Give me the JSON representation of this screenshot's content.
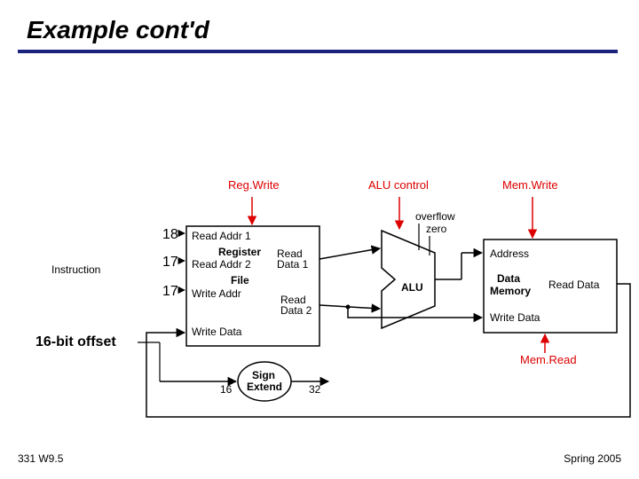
{
  "title": "Example cont'd",
  "signals": {
    "regwrite": "Reg.Write",
    "alucontrol": "ALU control",
    "memwrite": "Mem.Write",
    "memread": "Mem.Read",
    "overflow": "overflow",
    "zero": "zero"
  },
  "reg_inputs": {
    "a": "18",
    "b": "17",
    "c": "17"
  },
  "regfile": {
    "read_addr1": "Read Addr 1",
    "register": "Register",
    "read_addr2": "Read Addr 2",
    "file": "File",
    "write_addr": "Write Addr",
    "write_data": "Write Data",
    "read_data1_a": "Read",
    "read_data1_b": "Data 1",
    "read_data2_a": "Read",
    "read_data2_b": "Data 2"
  },
  "alu": {
    "label": "ALU"
  },
  "mem": {
    "address": "Address",
    "title_a": "Data",
    "title_b": "Memory",
    "read_data": "Read Data",
    "write_data": "Write Data"
  },
  "sign_extend": {
    "title_a": "Sign",
    "title_b": "Extend",
    "in_bits": "16",
    "out_bits": "32"
  },
  "labels": {
    "instruction": "Instruction",
    "offset": "16-bit offset"
  },
  "footer": {
    "left": "331 W9.5",
    "right": "Spring 2005"
  }
}
